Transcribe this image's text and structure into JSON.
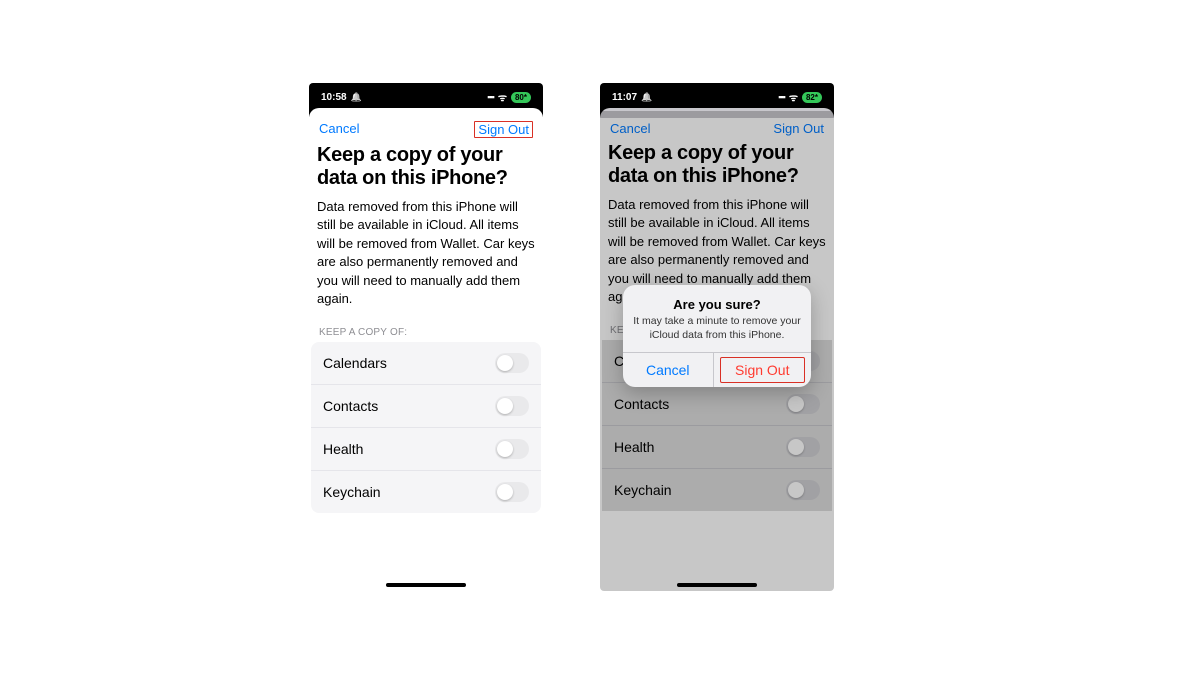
{
  "left": {
    "status": {
      "time": "10:58",
      "battery": "80"
    },
    "nav": {
      "cancel": "Cancel",
      "signout": "Sign Out"
    },
    "title": "Keep a copy of your data on this iPhone?",
    "body": "Data removed from this iPhone will still be available in iCloud. All items will be removed from Wallet. Car keys are also permanently removed and you will need to manually add them again.",
    "section_header": "KEEP A COPY OF:",
    "items": [
      {
        "label": "Calendars"
      },
      {
        "label": "Contacts"
      },
      {
        "label": "Health"
      },
      {
        "label": "Keychain"
      }
    ]
  },
  "right": {
    "status": {
      "time": "11:07",
      "battery": "82"
    },
    "nav": {
      "cancel": "Cancel",
      "signout": "Sign Out"
    },
    "title": "Keep a copy of your data on this iPhone?",
    "body": "Data removed from this iPhone will still be available in iCloud. All items will be removed from Wallet. Car keys are also permanently removed and you will need to manually add them again.",
    "section_header": "KEEP A COPY OF:",
    "items": [
      {
        "label": "Calendars"
      },
      {
        "label": "Contacts"
      },
      {
        "label": "Health"
      },
      {
        "label": "Keychain"
      }
    ],
    "alert": {
      "title": "Are you sure?",
      "message": "It may take a minute to remove your iCloud data from this iPhone.",
      "cancel": "Cancel",
      "signout": "Sign Out"
    }
  }
}
